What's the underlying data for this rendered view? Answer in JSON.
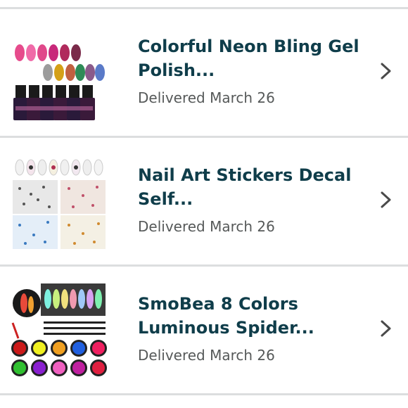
{
  "orders": [
    {
      "title_line1": "Colorful Neon Bling Gel",
      "title_line2": "Polish...",
      "status": "Delivered March 26",
      "thumb_icon": "gel-polish-bottles-image"
    },
    {
      "title_line1": "Nail Art Stickers Decal",
      "title_line2": "Self...",
      "status": "Delivered March 26",
      "thumb_icon": "nail-art-stickers-image"
    },
    {
      "title_line1": "SmoBea 8 Colors",
      "title_line2": "Luminous Spider...",
      "status": "Delivered March 26",
      "thumb_icon": "spider-gel-pots-image"
    }
  ],
  "colors": {
    "title": "#0f3d4a",
    "status": "#565959",
    "divider": "#dcdedf",
    "chevron": "#4a4a4a"
  }
}
